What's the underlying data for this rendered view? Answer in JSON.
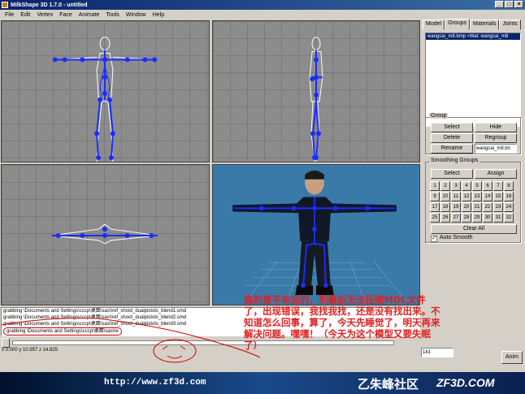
{
  "window": {
    "title": "MilkShape 3D 1.7.0 - untitled",
    "controls": [
      "_",
      "□",
      "×"
    ]
  },
  "menu": [
    "File",
    "Edit",
    "Vertex",
    "Face",
    "Animate",
    "Tools",
    "Window",
    "Help"
  ],
  "right_panel": {
    "tabs": [
      "Model",
      "Groups",
      "Materials",
      "Joints"
    ],
    "active_tab": "Groups",
    "group_list": [
      "wangcai_m8.bmp <Mat: wangcai_m8"
    ],
    "group_box": {
      "title": "Group",
      "buttons": [
        "Select",
        "Hide",
        "Delete",
        "Regroup",
        "Rename"
      ],
      "name_value": "wangcai_m8.bn"
    },
    "smoothing": {
      "title": "Smoothing Groups",
      "select_label": "Select",
      "assign_label": "Assign",
      "numbers": [
        "1",
        "2",
        "3",
        "4",
        "5",
        "6",
        "7",
        "8",
        "9",
        "10",
        "11",
        "12",
        "13",
        "14",
        "15",
        "16",
        "17",
        "18",
        "19",
        "20",
        "21",
        "22",
        "23",
        "24",
        "25",
        "26",
        "27",
        "28",
        "29",
        "30",
        "31",
        "32"
      ],
      "clear_all": "Clear All",
      "auto_smooth_label": "Auto Smooth",
      "auto_smooth_checked": true
    }
  },
  "console": {
    "lines": [
      "grabbing \\Documents and Settings\\cccp\\桌面\\sas\\\\ref_shoot_dualpistols_blend1.smd",
      "grabbing \\Documents and Settings\\cccp\\桌面\\sas\\\\ref_shoot_dualpistols_blend2.smd",
      "grabbing \\Documents and Settings\\cccp\\桌面\\sas\\\\ref_shoot_dualpistols_blend3.smd",
      "grabbing \\Documents and Settings\\cccp\\桌面\\sas\\re"
    ]
  },
  "timeline": {
    "frame_value": "141",
    "anim_label": "Anim"
  },
  "status": {
    "coords": "x 0.000 y 10.957 z 14.825"
  },
  "annotation": {
    "text": "真的是不幸运的，到最后无法压缩MDL文件了，出现错误，我找我找，还是没有找出来。不知道怎么回事，算了，今天先睡觉了，明天再来解决问题。嘿嘿！（今天为这个模型又要失眠了）",
    "color": "#e02020"
  },
  "footer": {
    "url": "http://www.zf3d.com",
    "site_cn": "乙朱峰社区",
    "site_en": "ZF3D.COM"
  }
}
